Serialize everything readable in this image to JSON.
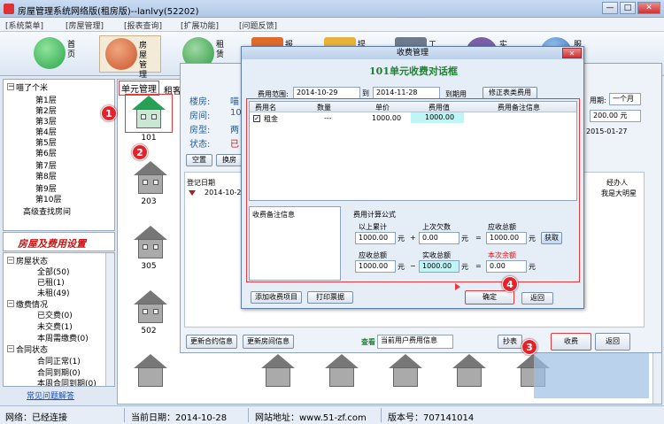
{
  "window": {
    "title": "房屋管理系统网络版(租房版)--lanlvy(52202)",
    "min": "—",
    "max": "□",
    "close": "✕"
  },
  "menu": [
    "[系统菜单]",
    "[房屋管理]",
    "[报表查询]",
    "[扩展功能]",
    "[问题反馈]"
  ],
  "toolbar": [
    {
      "label": "首页",
      "icon": "home-icon",
      "color": "#2aa54a"
    },
    {
      "label": "房屋管理",
      "icon": "house-icon",
      "color": "#c9552b"
    },
    {
      "label": "租赁",
      "icon": "recycle-icon",
      "color": "#2e9a3f"
    },
    {
      "label": "报",
      "icon": "report-icon",
      "color": "#e06a2c"
    },
    {
      "label": "提",
      "icon": "mail-icon",
      "color": "#e6b23a"
    },
    {
      "label": "工",
      "icon": "tools-icon",
      "color": "#6c7a8b"
    },
    {
      "label": "实",
      "icon": "clock-icon",
      "color": "#7a5fa6"
    },
    {
      "label": "服",
      "icon": "globe-icon",
      "color": "#2f6ebd"
    }
  ],
  "tree": {
    "root": "喵了个米",
    "floors": [
      "第1层",
      "第2层",
      "第3层",
      "第4层",
      "第5层",
      "第6层",
      "第7层",
      "第8层",
      "第9层",
      "第10层"
    ],
    "advanced": "高级查找房间"
  },
  "legend": "房屋及费用设置",
  "status_tree": {
    "house_status": "房屋状态",
    "all": "全部(50)",
    "rented": "已租(1)",
    "unrented": "未租(49)",
    "payment": "缴费情况",
    "paid": "已交费(0)",
    "unpaid": "未交费(1)",
    "due_week": "本周需缴费(0)",
    "contract": "合同状态",
    "normal": "合同正常(1)",
    "expired": "合同到期(0)",
    "expire_week": "本周合同到期(0)"
  },
  "help_link": "常见问题解答",
  "unit_tab": "单元管理",
  "unit_tab2": "租客",
  "rooms": [
    "101",
    "203",
    "305",
    "502"
  ],
  "room_info": {
    "building_label": "楼房:",
    "building": "喵",
    "room_label": "房间:",
    "room": "10",
    "type_label": "房型:",
    "type": "两",
    "status_label": "状态:",
    "status": "已"
  },
  "panel_buttons": {
    "vacant": "空置",
    "change": "换房"
  },
  "panel_right": {
    "period_label": "用期:",
    "period": "一个月",
    "amount": "200.00 元",
    "date": "2015-01-27"
  },
  "records": {
    "reg_date_label": "登记日期",
    "reg_date": "2014-10-28",
    "operator_label": "经办人",
    "operator": "我是大明星"
  },
  "bottom": {
    "update_contract": "更新合约信息",
    "update_room": "更新房间信息",
    "view_label": "查看",
    "view_value": "当前用户费用信息",
    "pay": "收费",
    "back": "返回",
    "extra": "抄表"
  },
  "dialog": {
    "title": "收费管理",
    "close": "✕",
    "header": "101单元收费对话框",
    "range_label": "费用范围:",
    "start": "2014-10-29",
    "end": "2014-11-28",
    "to": "到",
    "range_suffix": "到期用",
    "modify_btn": "修正表类费用",
    "columns": [
      "费用名",
      "数量",
      "单价",
      "费用值",
      "费用备注信息"
    ],
    "row": {
      "name": "租金",
      "qty": "---",
      "price": "1000.00",
      "value": "1000.00",
      "note": ""
    },
    "remark_label": "收费备注信息",
    "formula_label": "费用计算公式",
    "prev_total_label": "以上累计",
    "prev_total": "1000.00",
    "unit_yuan": "元",
    "last_owed_label": "上次欠数",
    "last_owed": "0.00",
    "receivable_label": "应收总额",
    "receivable": "1000.00",
    "fetch_btn": "获取",
    "receivable2_label": "应收总额",
    "receivable2": "1000.00",
    "actual_label": "实收总额",
    "actual": "1000.00",
    "balance_label": "本次余额",
    "balance": "0.00",
    "add_item": "添加收费项目",
    "print": "打印票据",
    "ok": "确定",
    "back": "返回",
    "plus": "+",
    "eq": "=",
    "minus": "−"
  },
  "markers": [
    "1",
    "2",
    "3",
    "4"
  ],
  "statusbar": {
    "network": "网络：已经连接",
    "date": "当前日期：2014-10-28",
    "site": "网站地址：www.51-zf.com",
    "version": "版本号：707141014"
  },
  "colors": {
    "accent_red": "#e8393f",
    "title_green": "#218034",
    "highlight_cyan": "#bff5f5"
  }
}
